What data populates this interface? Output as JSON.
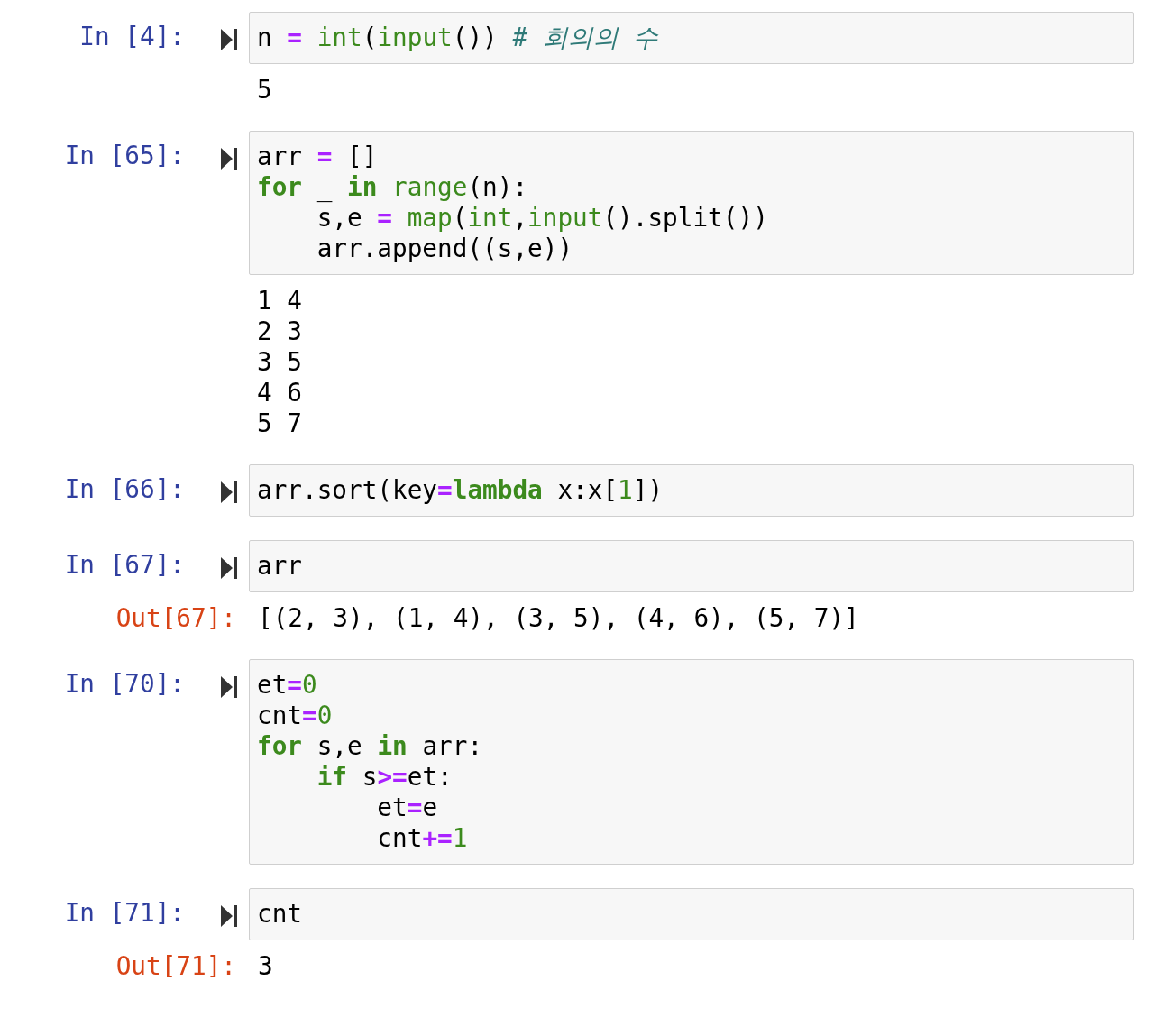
{
  "cells": [
    {
      "prompt": "In [4]:",
      "code": [
        [
          {
            "text": "n ",
            "kind": "name"
          },
          {
            "text": "= ",
            "kind": "op"
          },
          {
            "text": "int",
            "kind": "builtin"
          },
          {
            "text": "(",
            "kind": "name"
          },
          {
            "text": "input",
            "kind": "builtin"
          },
          {
            "text": "()) ",
            "kind": "name"
          },
          {
            "text": "# 회의의 수",
            "kind": "comment"
          }
        ]
      ],
      "output": {
        "lines": [
          "5"
        ]
      }
    },
    {
      "prompt": "In [65]:",
      "code": [
        [
          {
            "text": "arr ",
            "kind": "name"
          },
          {
            "text": "=",
            "kind": "op"
          },
          {
            "text": " []",
            "kind": "name"
          }
        ],
        [
          {
            "text": "for",
            "kind": "keyword"
          },
          {
            "text": " _ ",
            "kind": "name"
          },
          {
            "text": "in ",
            "kind": "keyword"
          },
          {
            "text": "range",
            "kind": "builtin"
          },
          {
            "text": "(n):",
            "kind": "name"
          }
        ],
        [
          {
            "text": "    s,e ",
            "kind": "name"
          },
          {
            "text": "= ",
            "kind": "op"
          },
          {
            "text": "map",
            "kind": "builtin"
          },
          {
            "text": "(",
            "kind": "name"
          },
          {
            "text": "int",
            "kind": "builtin"
          },
          {
            "text": ",",
            "kind": "name"
          },
          {
            "text": "input",
            "kind": "builtin"
          },
          {
            "text": "().split())",
            "kind": "name"
          }
        ],
        [
          {
            "text": "    arr.append((s,e))",
            "kind": "name"
          }
        ]
      ],
      "output": {
        "lines": [
          "1 4",
          "2 3",
          "3 5",
          "4 6",
          "5 7"
        ]
      }
    },
    {
      "prompt": "In [66]:",
      "code": [
        [
          {
            "text": "arr.sort(key",
            "kind": "name"
          },
          {
            "text": "=",
            "kind": "op"
          },
          {
            "text": "lambda",
            "kind": "keyword"
          },
          {
            "text": " x:x[",
            "kind": "name"
          },
          {
            "text": "1",
            "kind": "number"
          },
          {
            "text": "])",
            "kind": "name"
          }
        ]
      ]
    },
    {
      "prompt": "In [67]:",
      "code": [
        [
          {
            "text": "arr",
            "kind": "name"
          }
        ]
      ],
      "output": {
        "prompt": "Out[67]:",
        "lines": [
          "[(2, 3), (1, 4), (3, 5), (4, 6), (5, 7)]"
        ]
      }
    },
    {
      "prompt": "In [70]:",
      "code": [
        [
          {
            "text": "et",
            "kind": "name"
          },
          {
            "text": "=",
            "kind": "op"
          },
          {
            "text": "0",
            "kind": "number"
          }
        ],
        [
          {
            "text": "cnt",
            "kind": "name"
          },
          {
            "text": "=",
            "kind": "op"
          },
          {
            "text": "0",
            "kind": "number"
          }
        ],
        [
          {
            "text": "for",
            "kind": "keyword"
          },
          {
            "text": " s,e ",
            "kind": "name"
          },
          {
            "text": "in",
            "kind": "keyword"
          },
          {
            "text": " arr:",
            "kind": "name"
          }
        ],
        [
          {
            "text": "    if",
            "kind": "keyword"
          },
          {
            "text": " s",
            "kind": "name"
          },
          {
            "text": ">=",
            "kind": "op"
          },
          {
            "text": "et:",
            "kind": "name"
          }
        ],
        [
          {
            "text": "        et",
            "kind": "name"
          },
          {
            "text": "=",
            "kind": "op"
          },
          {
            "text": "e",
            "kind": "name"
          }
        ],
        [
          {
            "text": "        cnt",
            "kind": "name"
          },
          {
            "text": "+=",
            "kind": "op"
          },
          {
            "text": "1",
            "kind": "number"
          }
        ]
      ]
    },
    {
      "prompt": "In [71]:",
      "code": [
        [
          {
            "text": "cnt",
            "kind": "name"
          }
        ]
      ],
      "output": {
        "prompt": "Out[71]:",
        "lines": [
          "3"
        ]
      }
    }
  ]
}
